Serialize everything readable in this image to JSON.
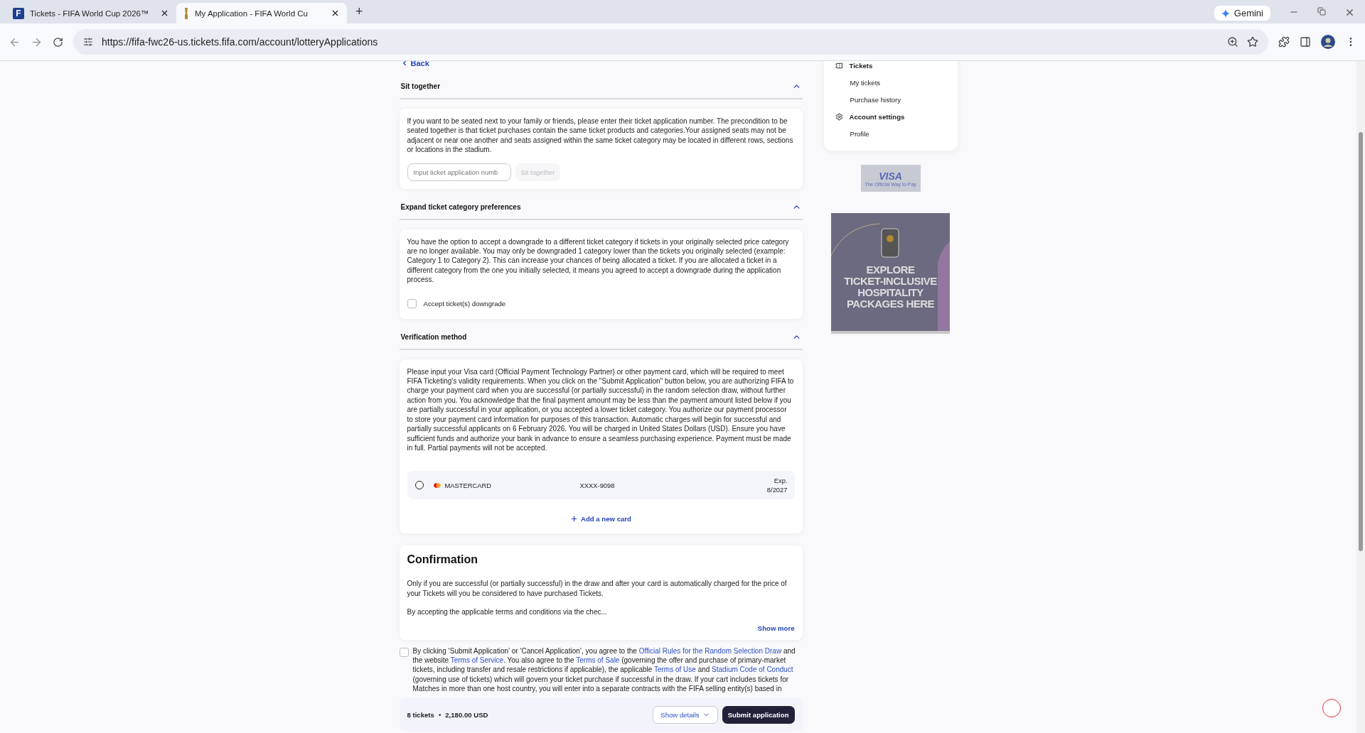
{
  "browser": {
    "tabs": [
      {
        "title": "Tickets - FIFA World Cup 2026™",
        "letter": "F",
        "selected": false
      },
      {
        "title": "My Application - FIFA World Cu",
        "selected": true
      }
    ],
    "new_tab": "+",
    "assistant": "Gemini",
    "url": "https://fifa-fwc26-us.tickets.fifa.com/account/lotteryApplications"
  },
  "page": {
    "back_link": "Back",
    "sections": [
      {
        "kind": "sit_together",
        "title": "Sit together",
        "expanded": true,
        "text": "If you want to be seated next to your family or friends, please enter their ticket application number. The precondition to be seated together is that ticket purchases contain the same ticket products and categories.Your assigned seats may not be adjacent or near one another and seats assigned within the same ticket category may be located in different rows, sections or locations in the stadium.",
        "placeholder": "Input ticket application numb",
        "button": "Sit together",
        "button_disabled": true
      },
      {
        "kind": "downgrade",
        "title": "Expand ticket category preferences",
        "expanded": true,
        "text": "You have the option to accept a downgrade to a different ticket category if tickets in your originally selected price category are no longer available. You may only be downgraded 1 category lower than the tickets you originally selected (example: Category 1 to Category 2). This can increase your chances of being allocated a ticket. If you are allocated a ticket in a different category from the one you initially selected, it means you agreed to accept a downgrade during the application process.",
        "checkbox_label": "Accept ticket(s) downgrade",
        "checked": false
      },
      {
        "kind": "verification",
        "title": "Verification method",
        "expanded": true,
        "text": "Please input your Visa card (Official Payment Technology Partner) or other payment card, which will be required to meet FIFA Ticketing's validity requirements. When you click on the \"Submit Application\" button below, you are authorizing FIFA to charge your payment card when you are successful (or partially successful) in the random selection draw, without further action from you. You acknowledge that the final payment amount may be less than the payment amount listed below if you are partially successful in your application, or you accepted a lower ticket category. You authorize our payment processor to store your payment card information for purposes of this transaction. Automatic charges will begin for successful and partially successful applicants on 6 February 2026. You will be charged in United States Dollars (USD). Ensure you have sufficient funds and authorize your bank in advance to ensure a seamless purchasing experience. Payment must be made in full. Partial payments will not be accepted.",
        "cards": [
          {
            "brand": "MASTERCARD",
            "number": "XXXX-9098",
            "exp_label": "Exp.",
            "exp_date": "8/2027",
            "selected": false
          }
        ],
        "add_card": "Add a new card"
      }
    ],
    "confirmation": {
      "title": "Confirmation",
      "paragraphs": [
        "Only if you are successful (or partially successful) in the draw and after your card is automatically charged for the price of your Tickets will you be considered to have purchased Tickets.",
        "By accepting the applicable terms and conditions via the chec..."
      ],
      "show_more": "Show more"
    },
    "terms": {
      "checked": false,
      "segments": [
        {
          "text": "By clicking ‘Submit Application’ or ‘Cancel Application’, you agree to the ",
          "link": false
        },
        {
          "text": "Official Rules for the Random Selection Draw",
          "link": true
        },
        {
          "text": " and the website ",
          "link": false
        },
        {
          "text": "Terms of Service",
          "link": true
        },
        {
          "text": ". You also agree to the ",
          "link": false
        },
        {
          "text": "Terms of Sale",
          "link": true
        },
        {
          "text": " (governing the offer and purchase of primary-market tickets, including transfer and resale restrictions if applicable), the applicable ",
          "link": false
        },
        {
          "text": "Terms of Use",
          "link": true
        },
        {
          "text": " and ",
          "link": false
        },
        {
          "text": "Stadium Code of Conduct",
          "link": true
        },
        {
          "text": " (governing use of tickets) which will govern your ticket purchase if successful in the draw. If your cart includes tickets for Matches in more than one host country, you will enter into a separate contracts with the FIFA selling entity(s) based in",
          "link": false
        }
      ]
    },
    "footer": {
      "count": "8 tickets",
      "separator": "•",
      "total": "2,180.00 USD",
      "details_button": "Show details",
      "submit_button": "Submit application"
    }
  },
  "sidebar": {
    "items": [
      {
        "label": "Tickets",
        "children": [
          {
            "label": "My tickets"
          },
          {
            "label": "Purchase history"
          }
        ]
      },
      {
        "label": "Account settings",
        "children": [
          {
            "label": "Profile"
          }
        ]
      }
    ],
    "sponsor": {
      "brand": "VISA",
      "tagline": "The Official Way to Pay"
    },
    "banner": {
      "lines": [
        "EXPLORE",
        "TICKET-INCLUSIVE",
        "HOSPITALITY",
        "PACKAGES HERE"
      ]
    }
  }
}
